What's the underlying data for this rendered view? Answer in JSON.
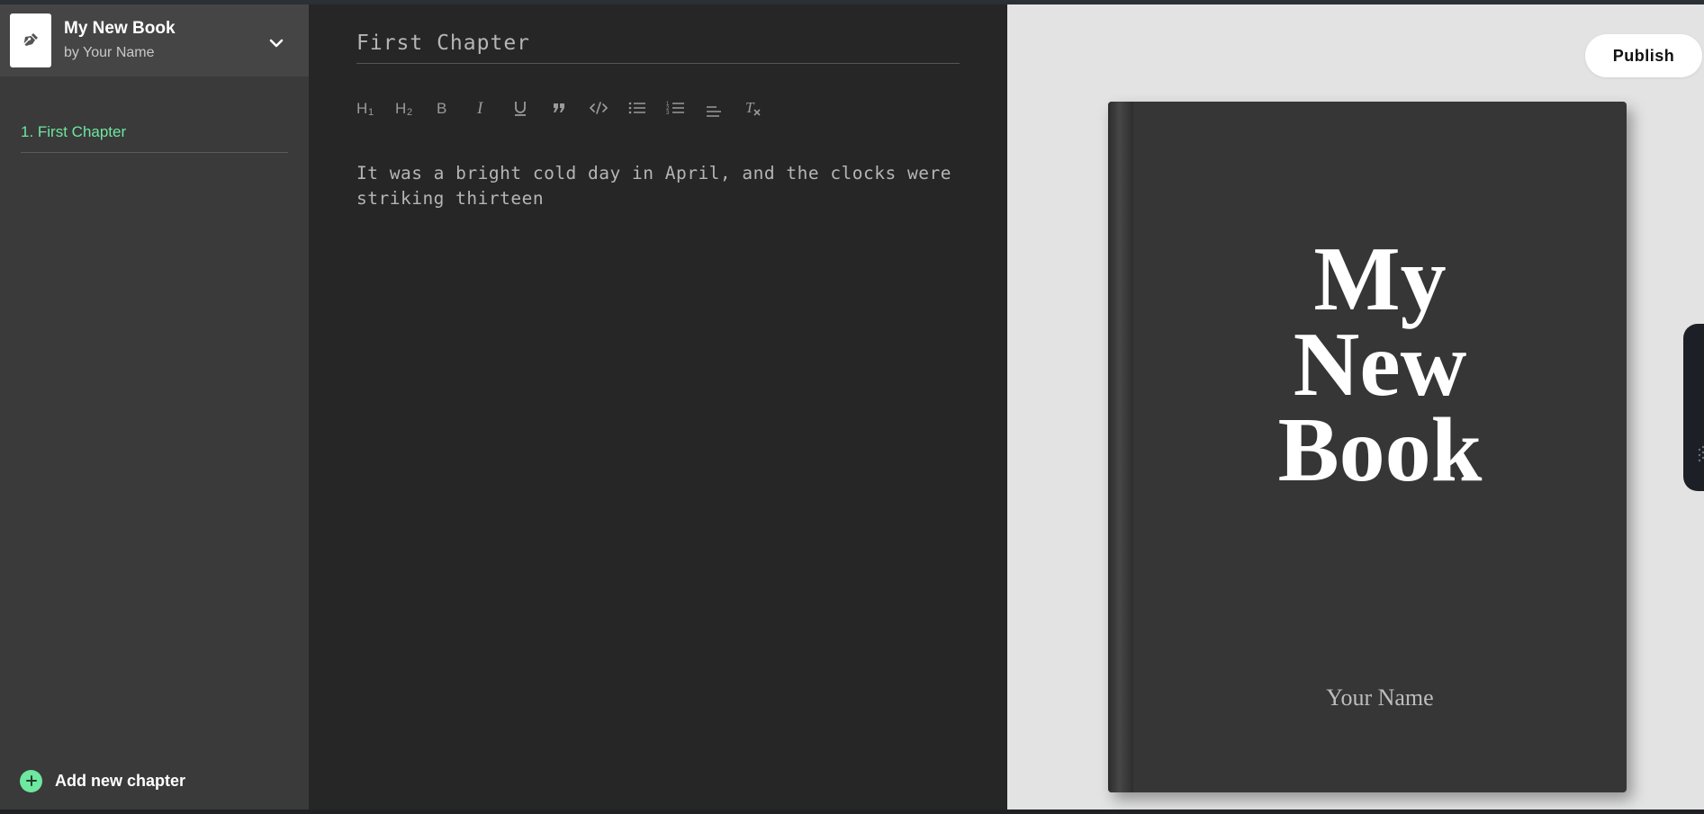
{
  "sidebar": {
    "book_title": "My New Book",
    "book_author": "by Your Name",
    "chapters": [
      {
        "label": "1. First Chapter"
      }
    ],
    "add_chapter_label": "Add new chapter"
  },
  "editor": {
    "chapter_title": "First Chapter",
    "toolbar": {
      "h1": "H1",
      "h2": "H2",
      "bold": "B",
      "italic": "I",
      "underline": "U",
      "quote": "”",
      "code": "</>",
      "bullet_list": "bulleted-list-icon",
      "numbered_list": "numbered-list-icon",
      "align": "align-icon",
      "clear_format": "Tx"
    },
    "body_text": "It was a bright cold day in April, and the clocks were striking thirteen"
  },
  "preview": {
    "publish_label": "Publish",
    "cover_title_lines": [
      "My",
      "New",
      "Book"
    ],
    "cover_author": "Your Name"
  },
  "colors": {
    "accent": "#6ee7a0",
    "sidebar_bg": "#3a3a3a",
    "editor_bg": "#262626",
    "preview_bg": "#e3e3e3",
    "cover_bg": "#363636"
  }
}
